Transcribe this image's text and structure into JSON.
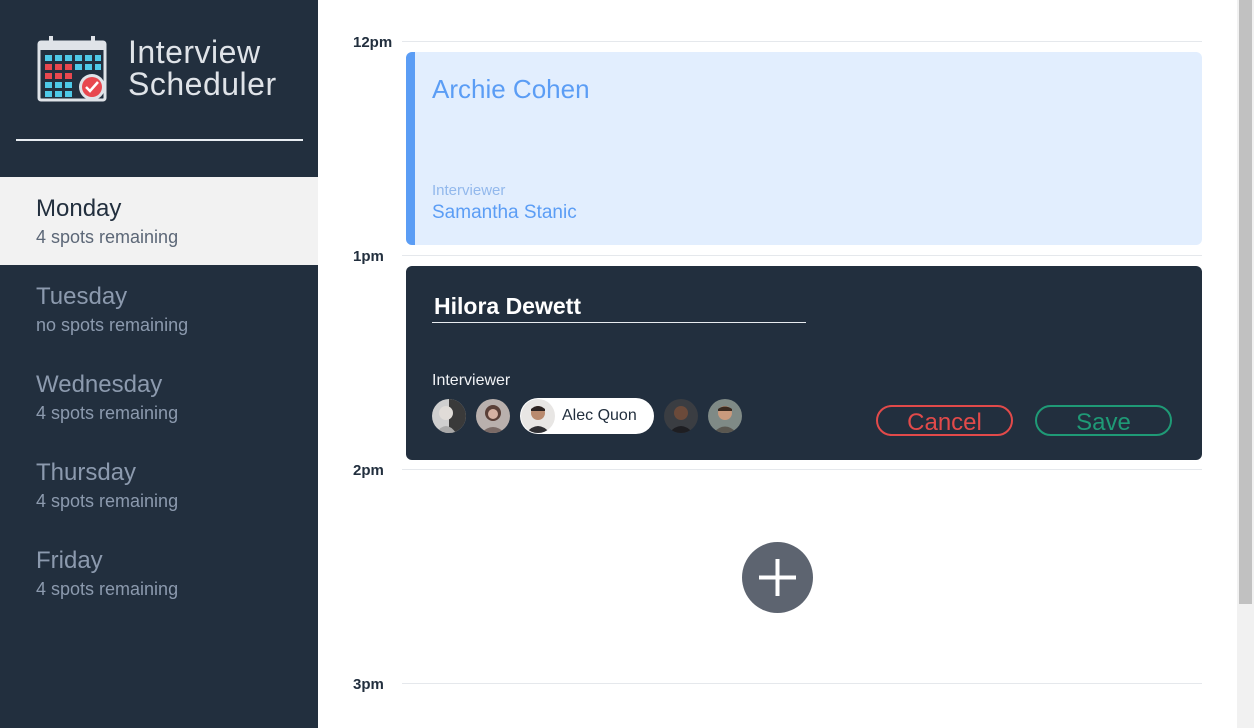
{
  "brand": {
    "line1": "Interview",
    "line2": "Scheduler",
    "icon": "calendar-check-icon"
  },
  "days": [
    {
      "name": "Monday",
      "spots": "4 spots remaining",
      "selected": true
    },
    {
      "name": "Tuesday",
      "spots": "no spots remaining",
      "selected": false
    },
    {
      "name": "Wednesday",
      "spots": "4 spots remaining",
      "selected": false
    },
    {
      "name": "Thursday",
      "spots": "4 spots remaining",
      "selected": false
    },
    {
      "name": "Friday",
      "spots": "4 spots remaining",
      "selected": false
    }
  ],
  "times": [
    "12pm",
    "1pm",
    "2pm",
    "3pm"
  ],
  "appointment_show": {
    "student": "Archie Cohen",
    "interviewer_label": "Interviewer",
    "interviewer": "Samantha Stanic"
  },
  "appointment_form": {
    "student_value": "Hilora Dewett",
    "interviewer_label": "Interviewer",
    "selected_interviewer": "Alec Quon",
    "cancel_label": "Cancel",
    "save_label": "Save"
  },
  "add_button": {
    "icon": "plus-icon"
  },
  "colors": {
    "sidebar": "#222f3e",
    "accent_blue": "#5b9df5",
    "cancel": "#e24a4a",
    "save": "#1f9a76"
  }
}
